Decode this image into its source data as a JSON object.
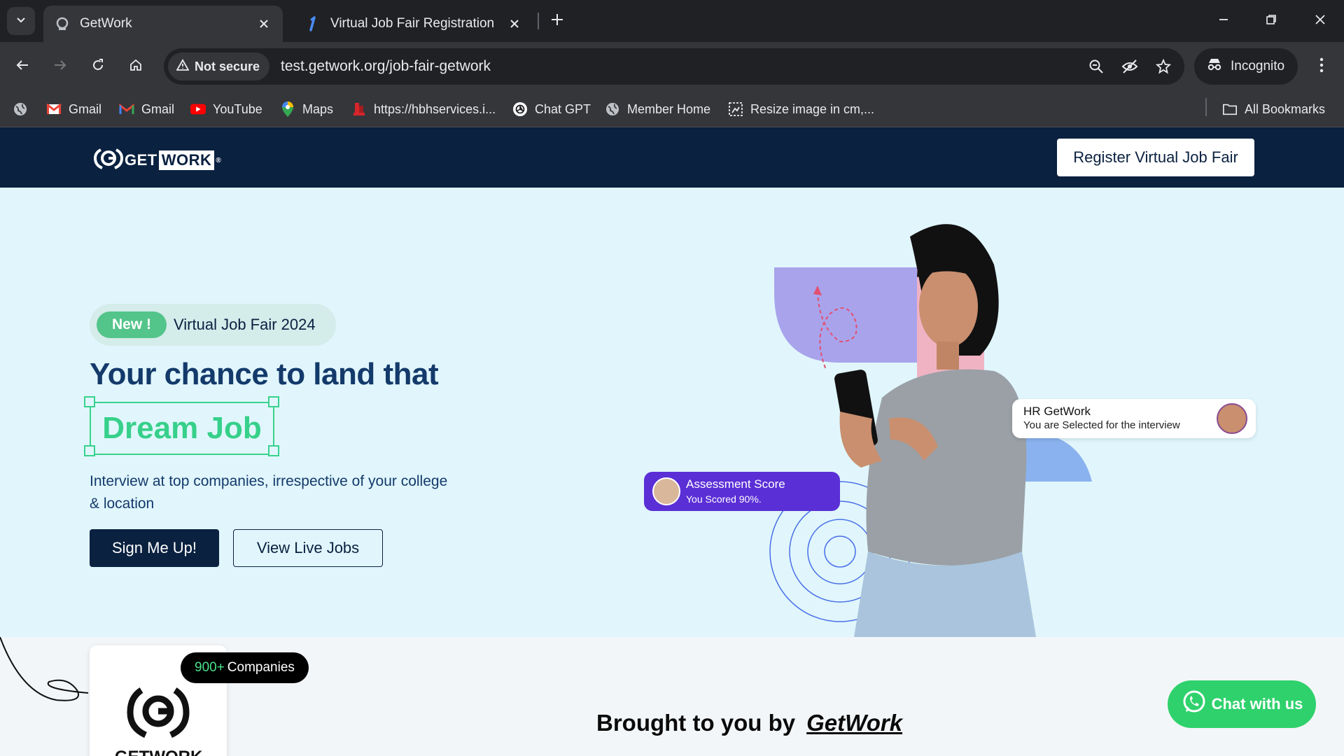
{
  "browser": {
    "tabs": [
      {
        "title": "GetWork",
        "active": true
      },
      {
        "title": "Virtual Job Fair Registration",
        "active": false
      }
    ],
    "security_label": "Not secure",
    "url": "test.getwork.org/job-fair-getwork",
    "profile_label": "Incognito",
    "bookmarks": [
      {
        "label": "Gmail",
        "icon": "gmail-icon"
      },
      {
        "label": "Gmail",
        "icon": "gmail-icon"
      },
      {
        "label": "YouTube",
        "icon": "youtube-icon"
      },
      {
        "label": "Maps",
        "icon": "maps-icon"
      },
      {
        "label": "https://hbhservices.i...",
        "icon": "site-icon"
      },
      {
        "label": "Chat GPT",
        "icon": "chatgpt-icon"
      },
      {
        "label": "Member Home",
        "icon": "globe-icon"
      },
      {
        "label": "Resize image in cm,...",
        "icon": "resize-icon"
      }
    ],
    "all_bookmarks_label": "All Bookmarks"
  },
  "header": {
    "logo_get": "GET",
    "logo_work": "WORK",
    "logo_mark": "®",
    "register_label": "Register Virtual Job Fair"
  },
  "hero": {
    "badge_new": "New !",
    "badge_label": "Virtual Job Fair 2024",
    "headline": "Your chance to land that",
    "highlight": "Dream Job",
    "subtext": "Interview at top companies, irrespective of your college & location",
    "signup_label": "Sign Me Up!",
    "viewjobs_label": "View Live Jobs",
    "hr_card": {
      "title": "HR GetWork",
      "message": "You are Selected for the interview"
    },
    "assessment_card": {
      "title": "Assessment Score",
      "message": "You Scored 90%."
    }
  },
  "partners": {
    "companies_count": "900+",
    "companies_label": "Companies",
    "logo_text": "GETWORK",
    "brought_label": "Brought to you by",
    "brand": "GetWork"
  },
  "chat": {
    "label": "Chat with us"
  },
  "colors": {
    "navy": "#0a2140",
    "accent_green": "#36d08a",
    "hero_bg": "#e0f6fc",
    "assessment_purple": "#5b2fd6",
    "whatsapp_green": "#2fd16c"
  }
}
